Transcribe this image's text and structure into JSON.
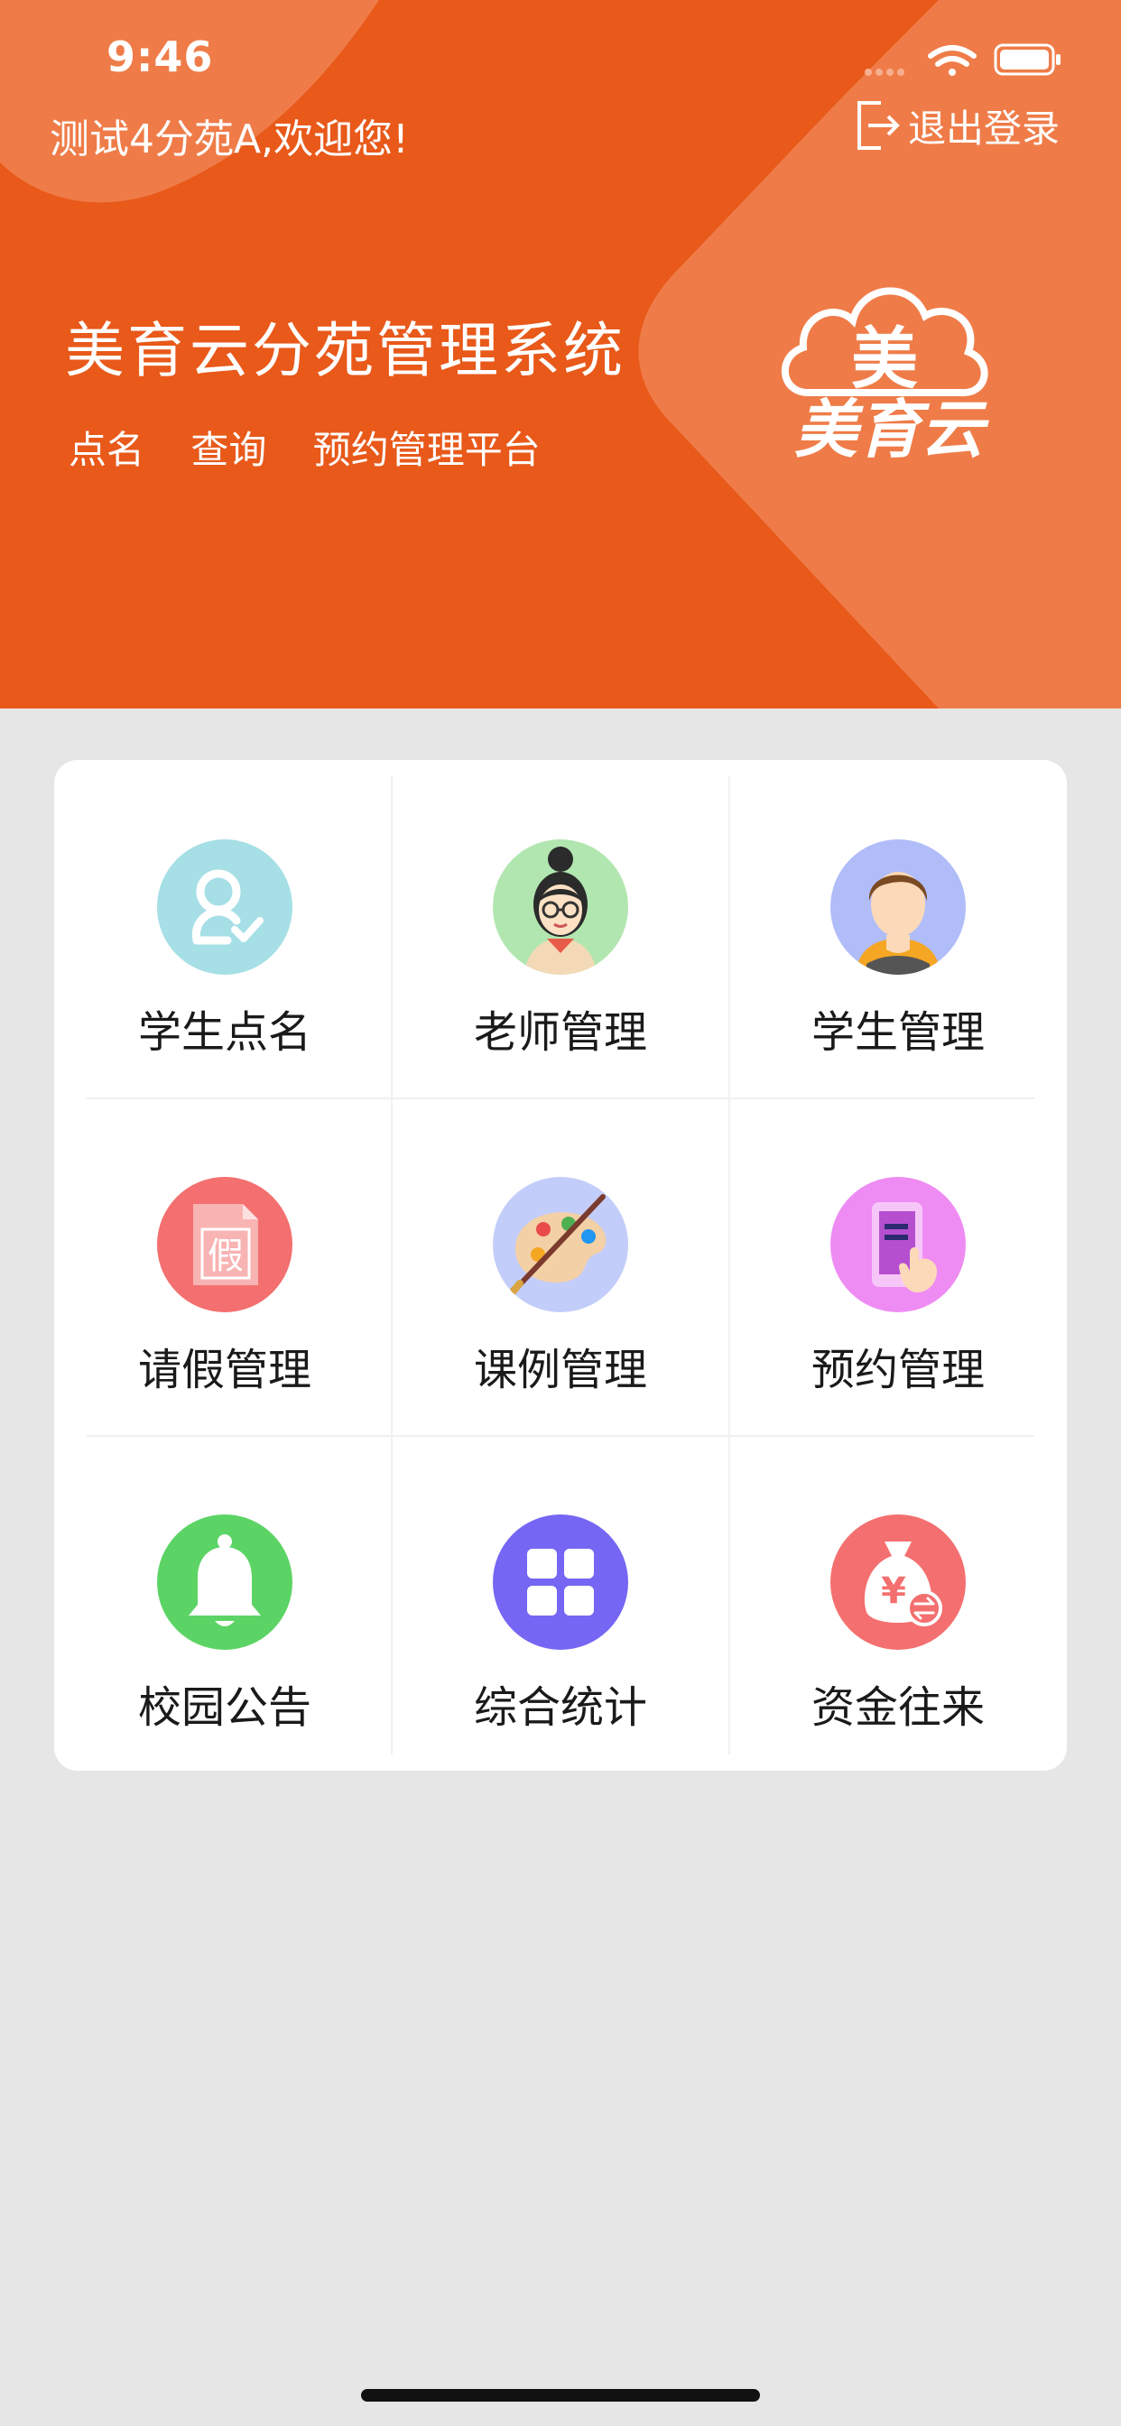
{
  "status_bar": {
    "time": "9:46"
  },
  "header": {
    "welcome": "测试4分苑A,欢迎您!",
    "logout_label": "退出登录",
    "title": "美育云分苑管理系统",
    "subtitle_items": [
      "点名",
      "查询",
      "预约管理平台"
    ],
    "logo_text": "美育云",
    "bg_color": "#e8591a"
  },
  "menu": {
    "items": [
      {
        "label": "学生点名",
        "icon": "student-checkin-icon",
        "color": "#a6dfe6"
      },
      {
        "label": "老师管理",
        "icon": "teacher-avatar-icon",
        "color": "#b2e6b0"
      },
      {
        "label": "学生管理",
        "icon": "student-avatar-icon",
        "color": "#b1bdf9"
      },
      {
        "label": "请假管理",
        "icon": "leave-document-icon",
        "color": "#f46f6f"
      },
      {
        "label": "课例管理",
        "icon": "palette-icon",
        "color": "#c3cdf9"
      },
      {
        "label": "预约管理",
        "icon": "phone-booking-icon",
        "color": "#ee8cf3"
      },
      {
        "label": "校园公告",
        "icon": "bell-icon",
        "color": "#5cd465"
      },
      {
        "label": "综合统计",
        "icon": "grid-stats-icon",
        "color": "#7566f3"
      },
      {
        "label": "资金往来",
        "icon": "money-bag-icon",
        "color": "#f46f6f"
      }
    ]
  }
}
